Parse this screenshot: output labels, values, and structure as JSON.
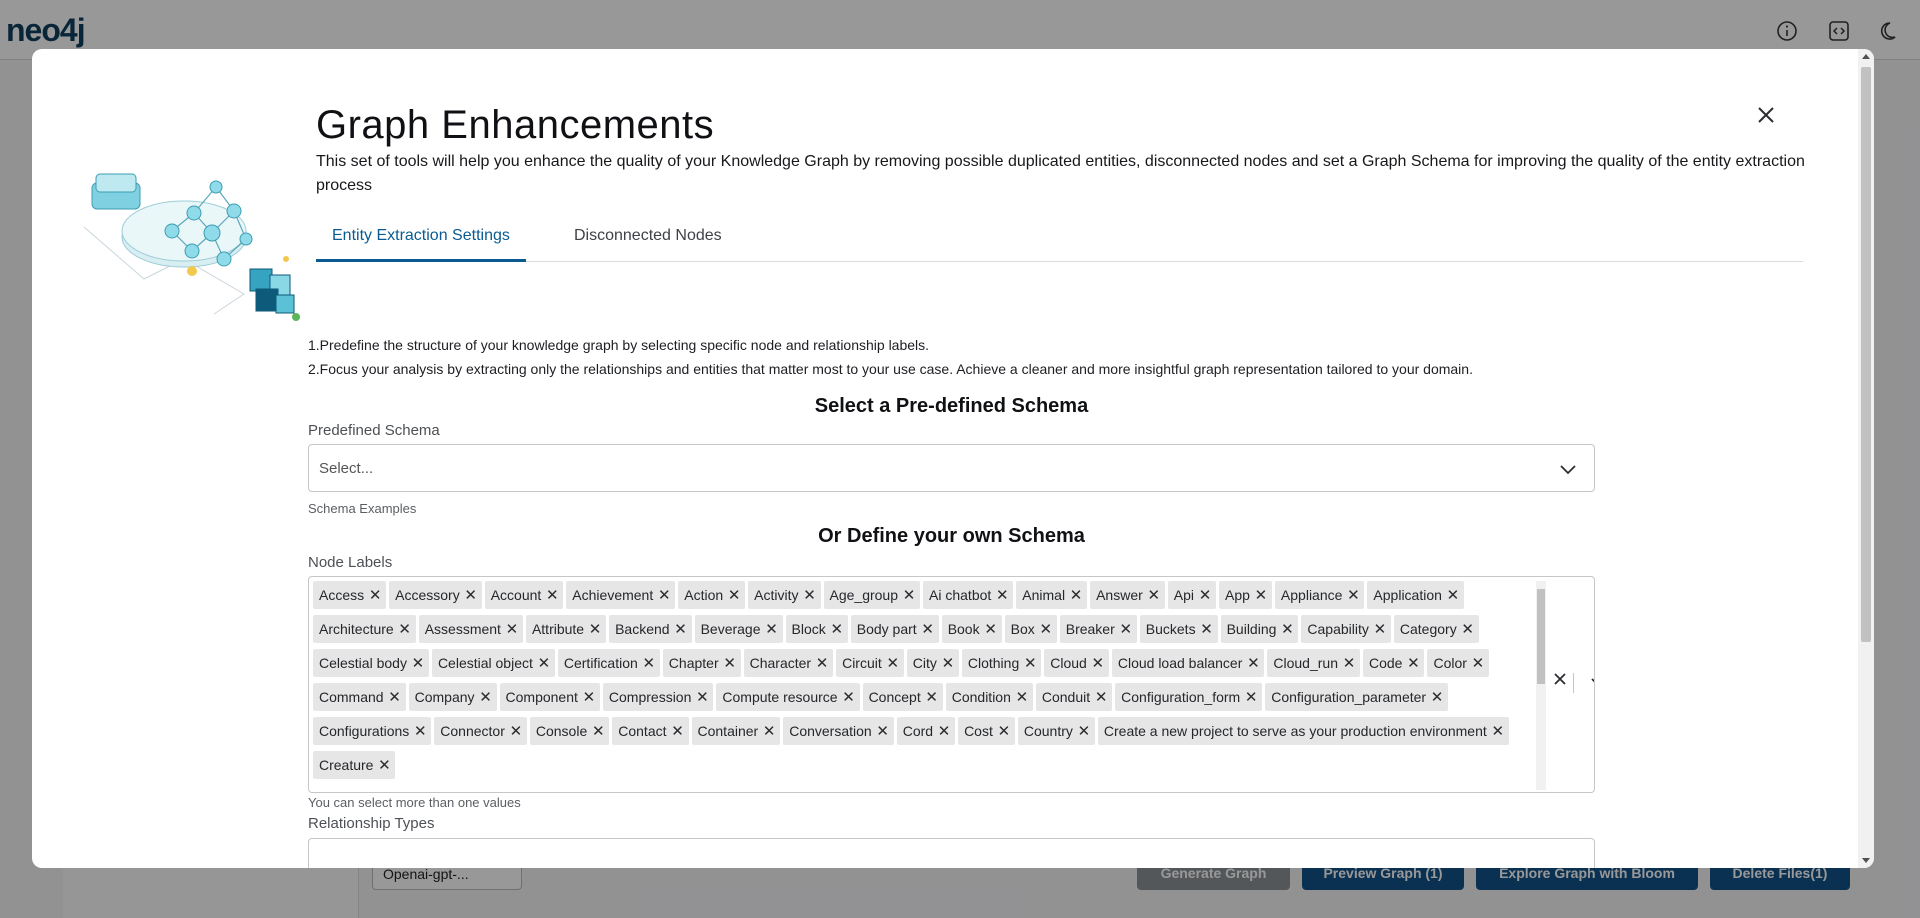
{
  "app": {
    "logo_text": "neo4j"
  },
  "background": {
    "model_select": "Openai-gpt-...",
    "buttons": [
      {
        "label": "Generate Graph",
        "color": "#8a8f95"
      },
      {
        "label": "Preview Graph (1)",
        "color": "#0b4f86"
      },
      {
        "label": "Explore Graph with Bloom",
        "color": "#0b4f86"
      },
      {
        "label": "Delete Files(1)",
        "color": "#0b4f86"
      }
    ]
  },
  "modal": {
    "title": "Graph Enhancements",
    "subtitle": "This set of tools will help you enhance the quality of your Knowledge Graph by removing possible duplicated entities, disconnected nodes and set a Graph Schema for improving the quality of the entity extraction process",
    "tabs": [
      {
        "label": "Entity Extraction Settings",
        "active": true
      },
      {
        "label": "Disconnected Nodes",
        "active": false
      }
    ],
    "instructions": [
      "1.Predefine the structure of your knowledge graph by selecting specific node and relationship labels.",
      "2.Focus your analysis by extracting only the relationships and entities that matter most to your use case. Achieve a cleaner and more insightful graph representation tailored to your domain."
    ],
    "predefined_heading": "Select a Pre-defined Schema",
    "predefined_label": "Predefined Schema",
    "predefined_placeholder": "Select...",
    "schema_examples": "Schema Examples",
    "own_heading": "Or Define your own Schema",
    "node_labels_label": "Node Labels",
    "node_labels": [
      "Access",
      "Accessory",
      "Account",
      "Achievement",
      "Action",
      "Activity",
      "Age_group",
      "Ai chatbot",
      "Animal",
      "Answer",
      "Api",
      "App",
      "Appliance",
      "Application",
      "Architecture",
      "Assessment",
      "Attribute",
      "Backend",
      "Beverage",
      "Block",
      "Body part",
      "Book",
      "Box",
      "Breaker",
      "Buckets",
      "Building",
      "Capability",
      "Category",
      "Celestial body",
      "Celestial object",
      "Certification",
      "Chapter",
      "Character",
      "Circuit",
      "City",
      "Clothing",
      "Cloud",
      "Cloud load balancer",
      "Cloud_run",
      "Code",
      "Color",
      "Command",
      "Company",
      "Component",
      "Compression",
      "Compute resource",
      "Concept",
      "Condition",
      "Conduit",
      "Configuration_form",
      "Configuration_parameter",
      "Configurations",
      "Connector",
      "Console",
      "Contact",
      "Container",
      "Conversation",
      "Cord",
      "Cost",
      "Country",
      "Create a new project to serve as your production environment",
      "Creature"
    ],
    "hint": "You can select more than one values",
    "relationship_label": "Relationship Types"
  },
  "colors": {
    "accent": "#0a5b92",
    "chip_bg": "#e6e6e6"
  }
}
